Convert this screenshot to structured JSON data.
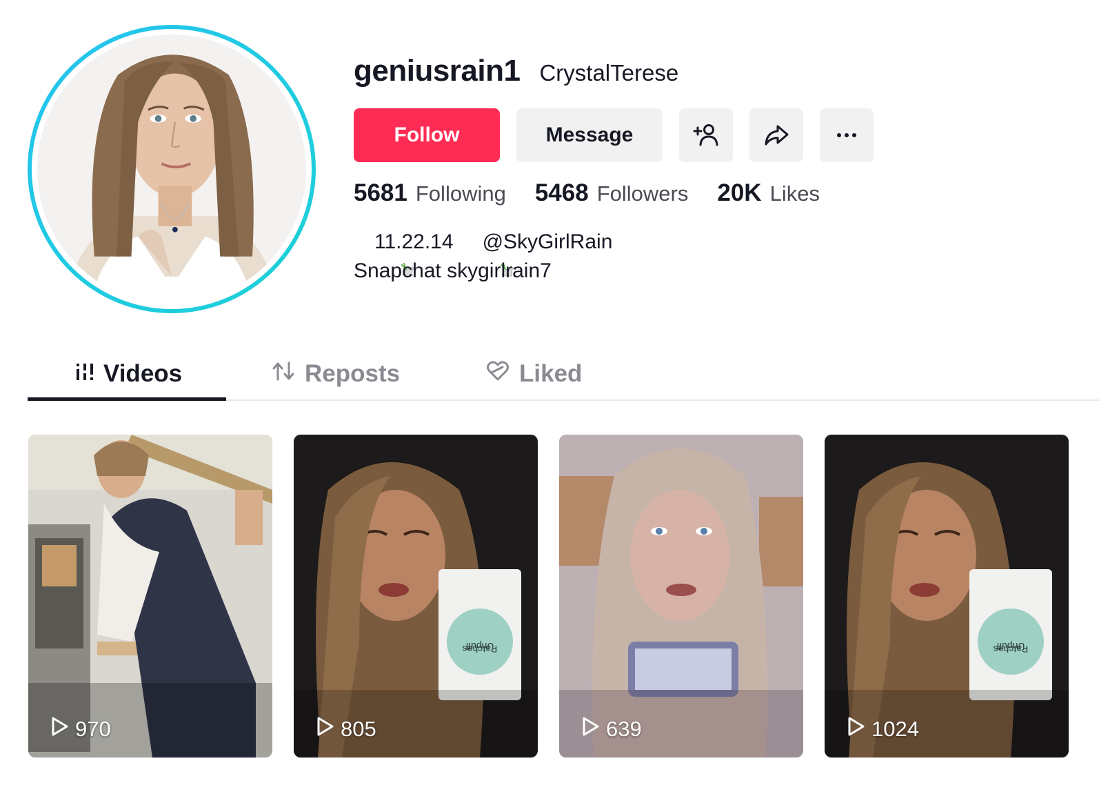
{
  "profile": {
    "username": "geniusrain1",
    "nickname": "CrystalTerese",
    "avatar_ring_color": "#25c3ee"
  },
  "actions": {
    "follow_label": "Follow",
    "message_label": "Message",
    "add_friend_icon": "add-friend-icon",
    "share_icon": "share-icon",
    "more_icon": "more-icon",
    "follow_color": "#fe2c55"
  },
  "stats": {
    "following": {
      "value": "5681",
      "label": "Following"
    },
    "followers": {
      "value": "5468",
      "label": "Followers"
    },
    "likes": {
      "value": "20K",
      "label": "Likes"
    }
  },
  "bio": {
    "line1_text": "11.22.14",
    "line1_handle": "@SkyGirlRain",
    "line2": "Snapchat skygirlrain7"
  },
  "tabs": [
    {
      "label": "Videos",
      "icon": "grid-icon",
      "active": true
    },
    {
      "label": "Reposts",
      "icon": "repost-icon",
      "active": false
    },
    {
      "label": "Liked",
      "icon": "heart-icon",
      "active": false
    }
  ],
  "videos": [
    {
      "views": "970"
    },
    {
      "views": "805"
    },
    {
      "views": "639"
    },
    {
      "views": "1024"
    }
  ]
}
